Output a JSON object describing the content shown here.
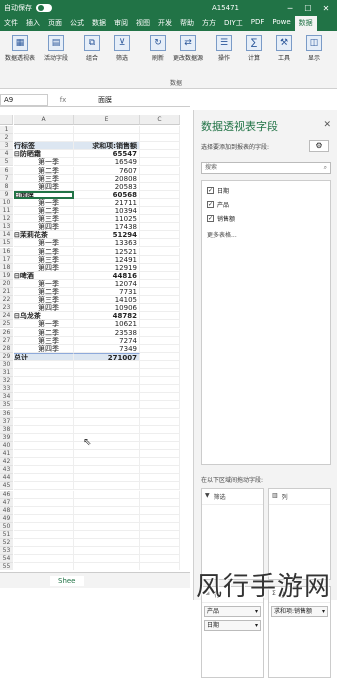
{
  "titlebar": {
    "autosave": "自动保存",
    "file_name": "A15471",
    "minimize": "─",
    "restore": "☐",
    "close": "✕"
  },
  "tabs": [
    "文件",
    "插入",
    "页面",
    "公式",
    "数据",
    "审阅",
    "视图",
    "开发",
    "帮助",
    "方方",
    "DIY工",
    "PDF",
    "Powe",
    "数据"
  ],
  "active_tab": "数据透视表分析",
  "ribbon": {
    "buttons": [
      {
        "label": "数据透视表",
        "icon": "pivot-table-icon"
      },
      {
        "label": "活动字段",
        "icon": "active-field-icon"
      },
      {
        "label": "组合",
        "icon": "group-icon"
      },
      {
        "label": "筛选",
        "icon": "filter-icon"
      },
      {
        "label": "刷新",
        "icon": "refresh-icon"
      },
      {
        "label": "更改数据源",
        "icon": "change-source-icon"
      },
      {
        "label": "操作",
        "icon": "actions-icon"
      },
      {
        "label": "计算",
        "icon": "calculation-icon"
      },
      {
        "label": "工具",
        "icon": "tools-icon"
      },
      {
        "label": "显示",
        "icon": "show-icon"
      }
    ],
    "group_label": "数据"
  },
  "formula_bar": {
    "name_box": "A9",
    "fx": "fx",
    "value": "面膜"
  },
  "sheet": {
    "columns": [
      "A",
      "E",
      "C"
    ],
    "rows": [
      {
        "n": "1",
        "a": "",
        "b": "",
        "type": "empty"
      },
      {
        "n": "2",
        "a": "",
        "b": "",
        "type": "empty"
      },
      {
        "n": "3",
        "a": "行标签",
        "b": "求和项:销售额",
        "type": "header"
      },
      {
        "n": "4",
        "a": "⊟防晒霜",
        "b": "65547",
        "type": "group"
      },
      {
        "n": "5",
        "a": "第一季",
        "b": "16549",
        "type": "child"
      },
      {
        "n": "6",
        "a": "第二季",
        "b": "7607",
        "type": "child"
      },
      {
        "n": "7",
        "a": "第三季",
        "b": "20808",
        "type": "child"
      },
      {
        "n": "8",
        "a": "第四季",
        "b": "20583",
        "type": "child"
      },
      {
        "n": "9",
        "a": "⊟面膜",
        "b": "60568",
        "type": "group"
      },
      {
        "n": "10",
        "a": "第一季",
        "b": "21711",
        "type": "child"
      },
      {
        "n": "11",
        "a": "第二季",
        "b": "10394",
        "type": "child"
      },
      {
        "n": "12",
        "a": "第三季",
        "b": "11025",
        "type": "child"
      },
      {
        "n": "13",
        "a": "第四季",
        "b": "17438",
        "type": "child"
      },
      {
        "n": "14",
        "a": "⊟茉莉花茶",
        "b": "51294",
        "type": "group"
      },
      {
        "n": "15",
        "a": "第一季",
        "b": "13363",
        "type": "child"
      },
      {
        "n": "16",
        "a": "第二季",
        "b": "12521",
        "type": "child"
      },
      {
        "n": "17",
        "a": "第三季",
        "b": "12491",
        "type": "child"
      },
      {
        "n": "18",
        "a": "第四季",
        "b": "12919",
        "type": "child"
      },
      {
        "n": "19",
        "a": "⊟啤酒",
        "b": "44816",
        "type": "group"
      },
      {
        "n": "20",
        "a": "第一季",
        "b": "12074",
        "type": "child"
      },
      {
        "n": "21",
        "a": "第二季",
        "b": "7731",
        "type": "child"
      },
      {
        "n": "22",
        "a": "第三季",
        "b": "14105",
        "type": "child"
      },
      {
        "n": "23",
        "a": "第四季",
        "b": "10906",
        "type": "child"
      },
      {
        "n": "24",
        "a": "⊟乌龙茶",
        "b": "48782",
        "type": "group"
      },
      {
        "n": "25",
        "a": "第一季",
        "b": "10621",
        "type": "child"
      },
      {
        "n": "26",
        "a": "第二季",
        "b": "23538",
        "type": "child"
      },
      {
        "n": "27",
        "a": "第三季",
        "b": "7274",
        "type": "child"
      },
      {
        "n": "28",
        "a": "第四季",
        "b": "7349",
        "type": "child"
      },
      {
        "n": "29",
        "a": "总计",
        "b": "271007",
        "type": "total"
      },
      {
        "n": "30",
        "a": "",
        "b": "",
        "type": "empty"
      },
      {
        "n": "31",
        "a": "",
        "b": "",
        "type": "empty"
      },
      {
        "n": "32",
        "a": "",
        "b": "",
        "type": "empty"
      },
      {
        "n": "33",
        "a": "",
        "b": "",
        "type": "empty"
      },
      {
        "n": "34",
        "a": "",
        "b": "",
        "type": "empty"
      },
      {
        "n": "35",
        "a": "",
        "b": "",
        "type": "empty"
      },
      {
        "n": "36",
        "a": "",
        "b": "",
        "type": "empty"
      },
      {
        "n": "37",
        "a": "",
        "b": "",
        "type": "empty"
      },
      {
        "n": "38",
        "a": "",
        "b": "",
        "type": "empty"
      },
      {
        "n": "39",
        "a": "",
        "b": "",
        "type": "empty"
      },
      {
        "n": "40",
        "a": "",
        "b": "",
        "type": "empty"
      },
      {
        "n": "41",
        "a": "",
        "b": "",
        "type": "empty"
      },
      {
        "n": "42",
        "a": "",
        "b": "",
        "type": "empty"
      },
      {
        "n": "43",
        "a": "",
        "b": "",
        "type": "empty"
      },
      {
        "n": "44",
        "a": "",
        "b": "",
        "type": "empty"
      },
      {
        "n": "45",
        "a": "",
        "b": "",
        "type": "empty"
      },
      {
        "n": "46",
        "a": "",
        "b": "",
        "type": "empty"
      },
      {
        "n": "47",
        "a": "",
        "b": "",
        "type": "empty"
      },
      {
        "n": "48",
        "a": "",
        "b": "",
        "type": "empty"
      },
      {
        "n": "49",
        "a": "",
        "b": "",
        "type": "empty"
      },
      {
        "n": "50",
        "a": "",
        "b": "",
        "type": "empty"
      },
      {
        "n": "51",
        "a": "",
        "b": "",
        "type": "empty"
      },
      {
        "n": "52",
        "a": "",
        "b": "",
        "type": "empty"
      },
      {
        "n": "53",
        "a": "",
        "b": "",
        "type": "empty"
      },
      {
        "n": "54",
        "a": "",
        "b": "",
        "type": "empty"
      },
      {
        "n": "55",
        "a": "",
        "b": "",
        "type": "empty"
      }
    ],
    "sheet_tab": "Shee"
  },
  "pane": {
    "title": "数据透视表字段",
    "close": "✕",
    "subtitle": "选择要添加到报表的字段:",
    "gear": "⚙",
    "search_placeholder": "搜索",
    "search_icon": "⌕",
    "fields": [
      {
        "label": "日期",
        "checked": true
      },
      {
        "label": "产品",
        "checked": true
      },
      {
        "label": "销售额",
        "checked": true
      }
    ],
    "more_tables": "更多表格...",
    "drag_tip": "在以下区域间拖动字段:",
    "areas": {
      "filter": {
        "label": "筛选",
        "icon": "filter-icon"
      },
      "columns": {
        "label": "列",
        "icon": "columns-icon"
      },
      "rows": {
        "label": "行",
        "icon": "rows-icon",
        "items": [
          "产品",
          "日期"
        ]
      },
      "values": {
        "label": "值",
        "icon": "sigma-icon",
        "items": [
          "求和项:销售额"
        ]
      }
    }
  },
  "watermark": "风行手游网"
}
